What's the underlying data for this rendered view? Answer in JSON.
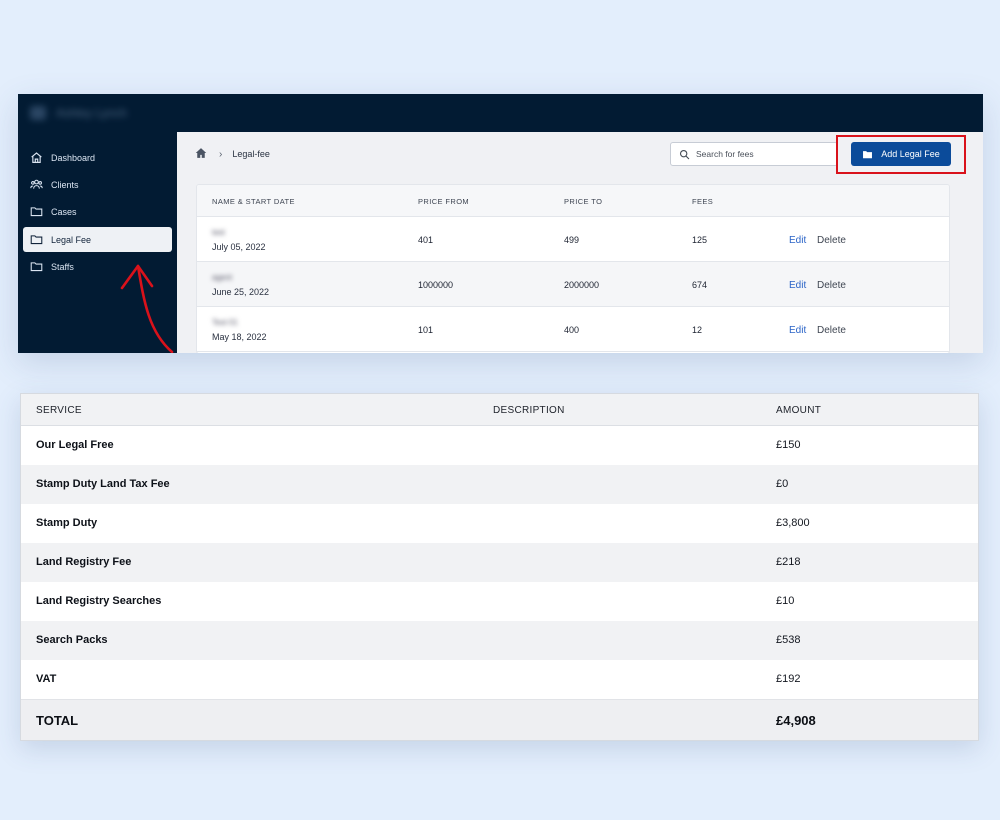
{
  "app": {
    "brand_blurred": "Ashley Lynch"
  },
  "sidebar": {
    "items": [
      {
        "label": "Dashboard",
        "icon": "home-icon"
      },
      {
        "label": "Clients",
        "icon": "users-icon"
      },
      {
        "label": "Cases",
        "icon": "folder-icon"
      },
      {
        "label": "Legal Fee",
        "icon": "folder-icon",
        "active": true
      },
      {
        "label": "Staffs",
        "icon": "folder-icon"
      }
    ]
  },
  "breadcrumb": {
    "current": "Legal-fee"
  },
  "search": {
    "placeholder": "Search for fees"
  },
  "toolbar": {
    "add_label": "Add Legal Fee",
    "accent": "#0b4b9a",
    "highlight": "#d9121b"
  },
  "fee_table": {
    "headers": [
      "NAME & START DATE",
      "PRICE FROM",
      "PRICE TO",
      "FEES"
    ],
    "rows": [
      {
        "name": "test",
        "date": "July 05, 2022",
        "price_from": "401",
        "price_to": "499",
        "fees": "125",
        "edit": "Edit",
        "delete": "Delete"
      },
      {
        "name": "agent",
        "date": "June 25, 2022",
        "price_from": "1000000",
        "price_to": "2000000",
        "fees": "674",
        "edit": "Edit",
        "delete": "Delete"
      },
      {
        "name": "Test 01",
        "date": "May 18, 2022",
        "price_from": "101",
        "price_to": "400",
        "fees": "12",
        "edit": "Edit",
        "delete": "Delete"
      }
    ]
  },
  "summary": {
    "headers": {
      "service": "SERVICE",
      "description": "DESCRIPTION",
      "amount": "AMOUNT"
    },
    "rows": [
      {
        "service": "Our Legal Free",
        "amount": "£150"
      },
      {
        "service": "Stamp Duty Land Tax Fee",
        "amount": "£0"
      },
      {
        "service": "Stamp Duty",
        "amount": "£3,800"
      },
      {
        "service": "Land Registry Fee",
        "amount": "£218"
      },
      {
        "service": "Land Registry Searches",
        "amount": "£10"
      },
      {
        "service": "Search Packs",
        "amount": "£538"
      },
      {
        "service": "VAT",
        "amount": "£192"
      }
    ],
    "total": {
      "label": "TOTAL",
      "amount": "£4,908"
    }
  }
}
